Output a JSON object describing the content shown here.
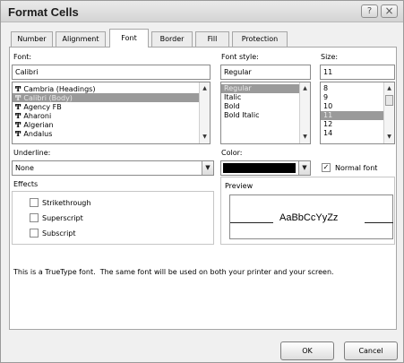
{
  "window": {
    "title": "Format Cells",
    "help_glyph": "?",
    "close_glyph": "×"
  },
  "tabs": [
    {
      "label": "Number"
    },
    {
      "label": "Alignment"
    },
    {
      "label": "Font"
    },
    {
      "label": "Border"
    },
    {
      "label": "Fill"
    },
    {
      "label": "Protection"
    }
  ],
  "font": {
    "label": "Font:",
    "value": "Calibri",
    "items": [
      "Cambria (Headings)",
      "Calibri (Body)",
      "Agency FB",
      "Aharoni",
      "Algerian",
      "Andalus"
    ],
    "selected": "Calibri (Body)",
    "tt_glyph": "Ͳ"
  },
  "font_style": {
    "label": "Font style:",
    "value": "Regular",
    "items": [
      "Regular",
      "Italic",
      "Bold",
      "Bold Italic"
    ],
    "selected": "Regular"
  },
  "size": {
    "label": "Size:",
    "value": "11",
    "items": [
      "8",
      "9",
      "10",
      "11",
      "12",
      "14"
    ],
    "selected": "11"
  },
  "underline": {
    "label": "Underline:",
    "value": "None"
  },
  "color": {
    "label": "Color:",
    "swatch": "#000000"
  },
  "normal_font": {
    "label": "Normal font",
    "checked": true
  },
  "effects": {
    "label": "Effects",
    "strikethrough": "Strikethrough",
    "superscript": "Superscript",
    "subscript": "Subscript"
  },
  "preview": {
    "label": "Preview",
    "sample": "AaBbCcYyZz"
  },
  "info_text": "This is a TrueType font.  The same font will be used on both your printer and your screen.",
  "buttons": {
    "ok": "OK",
    "cancel": "Cancel"
  },
  "scroll_glyphs": {
    "up": "▲",
    "down": "▼",
    "dropdown": "▼",
    "check": "✓"
  }
}
